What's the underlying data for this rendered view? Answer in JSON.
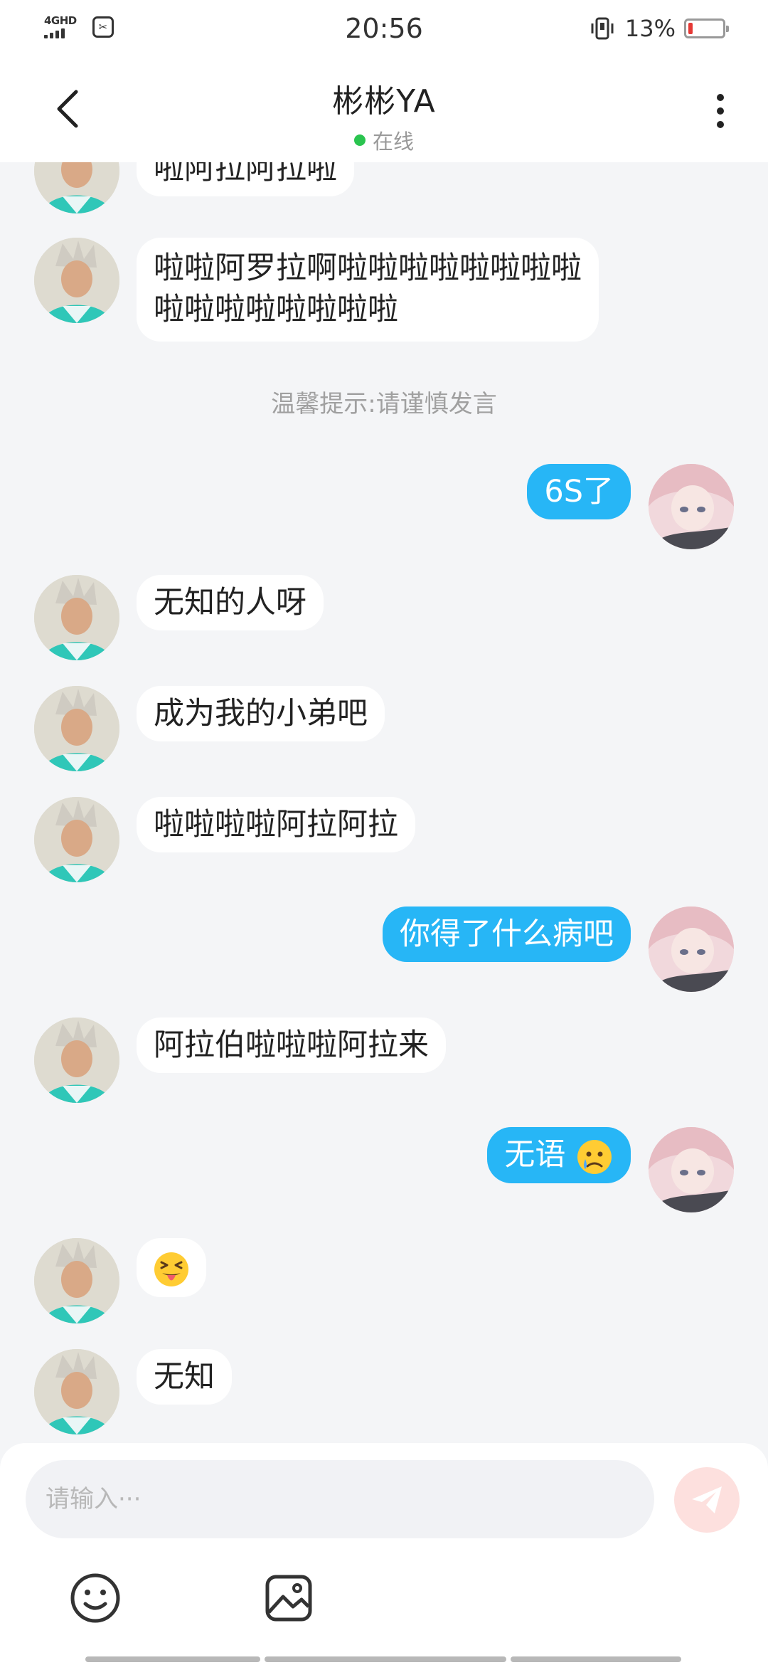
{
  "status_bar": {
    "network": "4GHD",
    "time": "20:56",
    "battery_percent": "13%",
    "battery_level": 0.13,
    "icons": [
      "signal-icon",
      "app-notification-icon",
      "vibrate-icon",
      "battery-icon"
    ]
  },
  "header": {
    "title": "彬彬YA",
    "status": "在线",
    "status_color": "#2ac44f"
  },
  "messages": [
    {
      "from": "them",
      "text": "啦阿拉阿拉啦"
    },
    {
      "from": "them",
      "lines": [
        "啦啦阿罗拉啊啦啦啦啦啦啦啦啦",
        "啦啦啦啦啦啦啦啦"
      ]
    },
    {
      "from": "system",
      "text": "温馨提示:请谨慎发言"
    },
    {
      "from": "me",
      "text": "6S了"
    },
    {
      "from": "them",
      "text": "无知的人呀"
    },
    {
      "from": "them",
      "text": "成为我的小弟吧"
    },
    {
      "from": "them",
      "text": "啦啦啦啦阿拉阿拉"
    },
    {
      "from": "me",
      "text": "你得了什么病吧"
    },
    {
      "from": "them",
      "text": "阿拉伯啦啦啦阿拉来"
    },
    {
      "from": "me",
      "text": "无语",
      "emoji": "crying-face"
    },
    {
      "from": "them",
      "emoji": "squinting-tongue-face"
    },
    {
      "from": "them",
      "text": "无知"
    }
  ],
  "input": {
    "placeholder": "请输入···"
  },
  "colors": {
    "my_bubble": "#27b6f6",
    "their_bubble": "#ffffff",
    "background": "#f4f5f7",
    "send_button": "#fde0de"
  },
  "toolbar_icons": [
    "emoji-icon",
    "image-icon",
    "send-icon"
  ]
}
